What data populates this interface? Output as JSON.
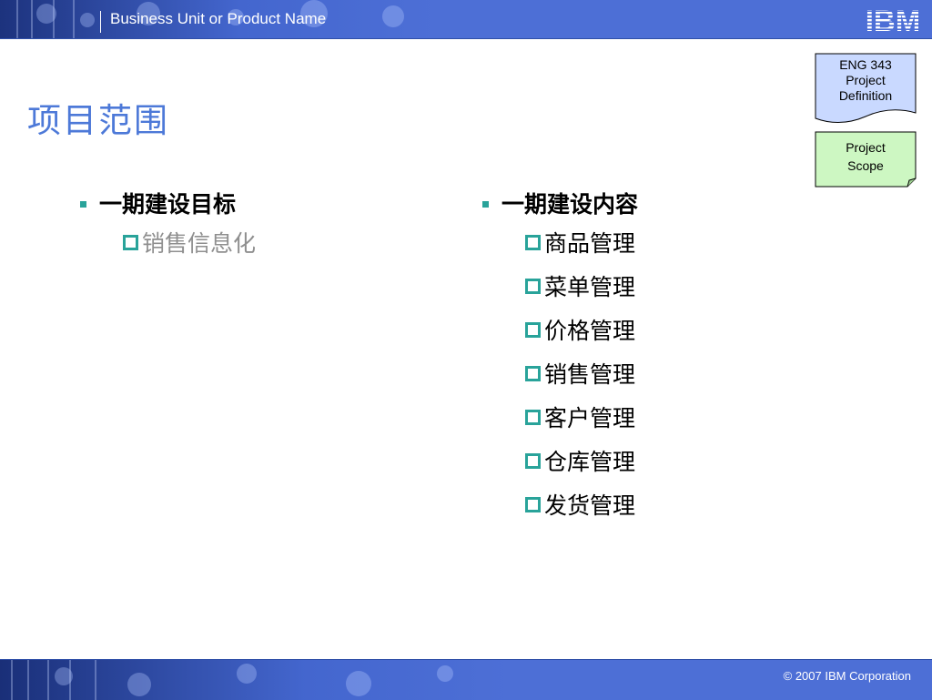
{
  "header": {
    "business_unit": "Business Unit or Product Name",
    "logo_text": "IBM"
  },
  "slide": {
    "title": "项目范围"
  },
  "side_boxes": {
    "definition_lines": [
      "ENG 343",
      "Project",
      "Definition"
    ],
    "scope_lines": [
      "Project",
      "Scope"
    ]
  },
  "left_column": {
    "heading": "一期建设目标",
    "items": [
      "销售信息化"
    ]
  },
  "right_column": {
    "heading": "一期建设内容",
    "items": [
      "商品管理",
      "菜单管理",
      "价格管理",
      "销售管理",
      "客户管理",
      "仓库管理",
      "发货管理"
    ]
  },
  "footer": {
    "copyright": "© 2007 IBM Corporation"
  },
  "colors": {
    "header_bar": "#4d6fd6",
    "title": "#4d79d8",
    "bullet_teal": "#29a39a",
    "definition_box_fill": "#c9d9ff",
    "scope_box_fill": "#cdf7c2",
    "gray_text": "#8f8f8f"
  }
}
